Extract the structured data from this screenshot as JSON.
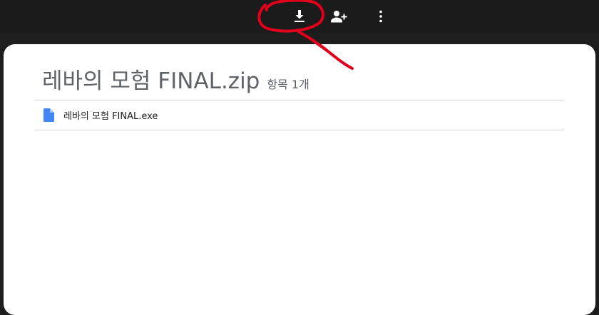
{
  "toolbar": {
    "download_icon": "download-icon",
    "share_icon": "person-add-icon",
    "more_icon": "more-vert-icon"
  },
  "archive": {
    "title": "레바의 모험 FINAL.zip",
    "item_count": "항목 1개"
  },
  "files": [
    {
      "name": "레바의 모험 FINAL.exe",
      "icon": "file-icon"
    }
  ],
  "colors": {
    "toolbar_bg": "#1b1b1b",
    "sheet_bg": "#ffffff",
    "file_icon": "#4285f4",
    "annotation": "#e0001b"
  }
}
